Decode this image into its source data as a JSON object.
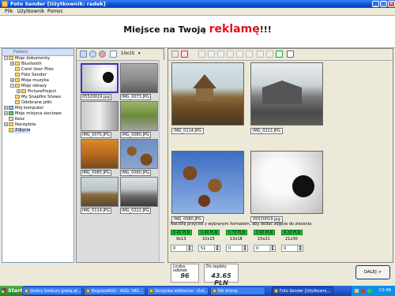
{
  "window": {
    "title": "Foto Sender [Użytkownik: radek]"
  },
  "menu": [
    "Plik",
    "Użytkownik",
    "Pomoc"
  ],
  "banner": {
    "pre": "Miejsce na Twoją ",
    "highlight": "reklamę",
    "post": "!!!"
  },
  "left_panel": {
    "header": "Foldery",
    "tree": [
      {
        "label": "Moje dokumenty",
        "icon": "folder-icon"
      },
      {
        "label": "Bluetooth",
        "icon": "folder-icon"
      },
      {
        "label": "Corel User Files",
        "icon": "folder-icon"
      },
      {
        "label": "Foto Sender",
        "icon": "folder-icon"
      },
      {
        "label": "Moja muzyka",
        "icon": "folder-icon"
      },
      {
        "label": "Moje obrazy",
        "icon": "folder-icon"
      },
      {
        "label": "PictureProject",
        "icon": "folder-icon"
      },
      {
        "label": "My Snapfire Shows",
        "icon": "folder-icon"
      },
      {
        "label": "Odebrane pliki",
        "icon": "folder-icon"
      },
      {
        "label": "Mój komputer",
        "icon": "computer-icon"
      },
      {
        "label": "Moje miejsca sieciowe",
        "icon": "network-icon"
      },
      {
        "label": "Kosz",
        "icon": "recycle-bin-icon"
      },
      {
        "label": "Narzędzia",
        "icon": "folder-icon"
      },
      {
        "label": "Zdjęcia",
        "icon": "folder-icon"
      }
    ]
  },
  "middle_panel": {
    "size_select": "10x15",
    "thumbnails": [
      {
        "name": "05520019.jpg",
        "selected": true
      },
      {
        "name": "IMG_0073.JPG"
      },
      {
        "name": "IMG_0075.JPG"
      },
      {
        "name": "IMG_0080.JPG"
      },
      {
        "name": "IMG_0085.JPG"
      },
      {
        "name": "IMG_0090.JPG"
      },
      {
        "name": "IMG_0114.JPG"
      },
      {
        "name": "IMG_0222.JPG"
      }
    ]
  },
  "right_panel": {
    "photos": [
      {
        "name": "IMG_0114.JPG"
      },
      {
        "name": "IMG_0222.JPG"
      },
      {
        "name": "IMG_0080.JPG"
      },
      {
        "name": "05520019.jpg"
      }
    ]
  },
  "pricing": {
    "instruction": "Naciśnij przycisk z wybranym formatem, aby dodać zdjęcie do zlecenia",
    "formats": [
      {
        "price": "0.40 PLN",
        "size": "9x13",
        "qty": "0"
      },
      {
        "price": "0.40 PLN",
        "size": "10x15",
        "qty": "51"
      },
      {
        "price": "0.70 PLN",
        "size": "13x18",
        "qty": "0"
      },
      {
        "price": "0.90 PLN",
        "size": "15x21",
        "qty": "0"
      },
      {
        "price": "4.20 PLN",
        "size": "21x30",
        "qty": "0"
      }
    ],
    "accent": "#23c23f"
  },
  "summary": {
    "count_label": "Liczba odbitek",
    "count_value": "96",
    "pay_label": "Do zapłaty",
    "pay_value": "43.65 PLN",
    "next_button": "DALEJ >"
  },
  "taskbar": {
    "start": "Start",
    "tasks": [
      "Gralny konkurs gredą at...",
      "BogusiaAGG - AGG: 582...",
      "Skrzynka odbiorcza - Out...",
      "NA stronę",
      "Foto Sender [Użytkowni..."
    ],
    "clock": "13:46"
  }
}
